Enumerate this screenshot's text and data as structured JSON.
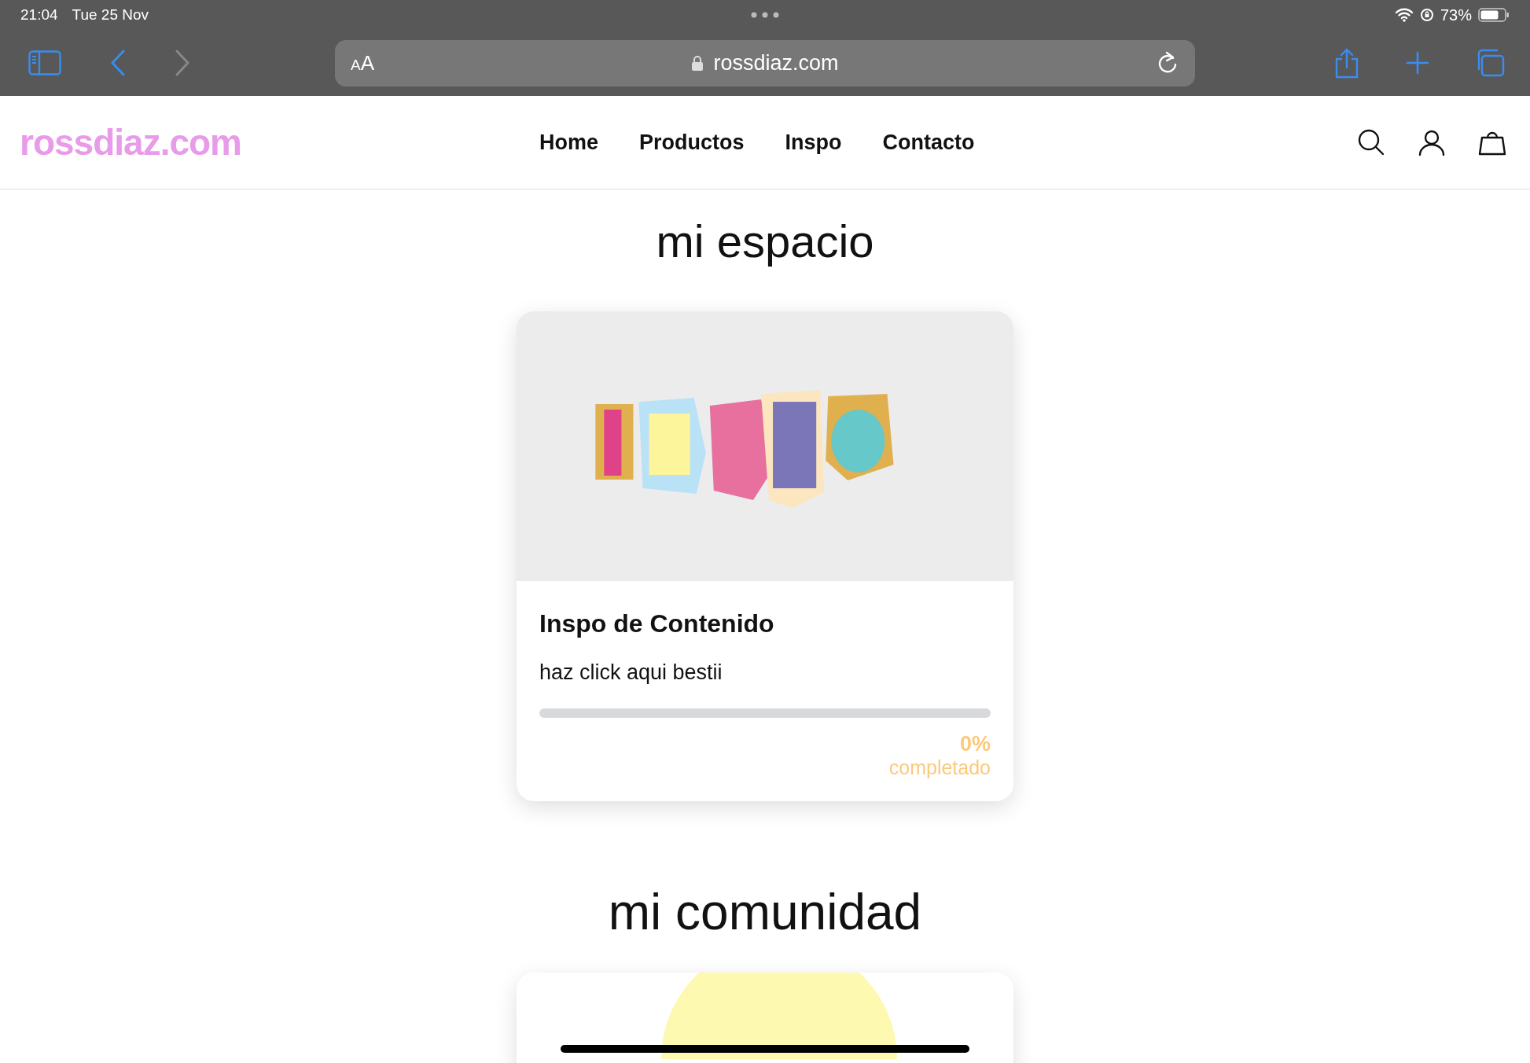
{
  "status_bar": {
    "time": "21:04",
    "date": "Tue 25 Nov",
    "battery": "73%"
  },
  "browser": {
    "text_size_button": "AA",
    "url": "rossdiaz.com"
  },
  "site": {
    "logo": "rossdiaz.com",
    "nav": [
      {
        "label": "Home"
      },
      {
        "label": "Productos"
      },
      {
        "label": "Inspo"
      },
      {
        "label": "Contacto"
      }
    ]
  },
  "sections": [
    {
      "heading": "mi espacio",
      "card": {
        "title": "Inspo de Contenido",
        "subtitle": "haz click aqui bestii",
        "level": 0,
        "percent": "0%",
        "progress_label": "completado"
      }
    },
    {
      "heading": "mi comunidad"
    }
  ]
}
